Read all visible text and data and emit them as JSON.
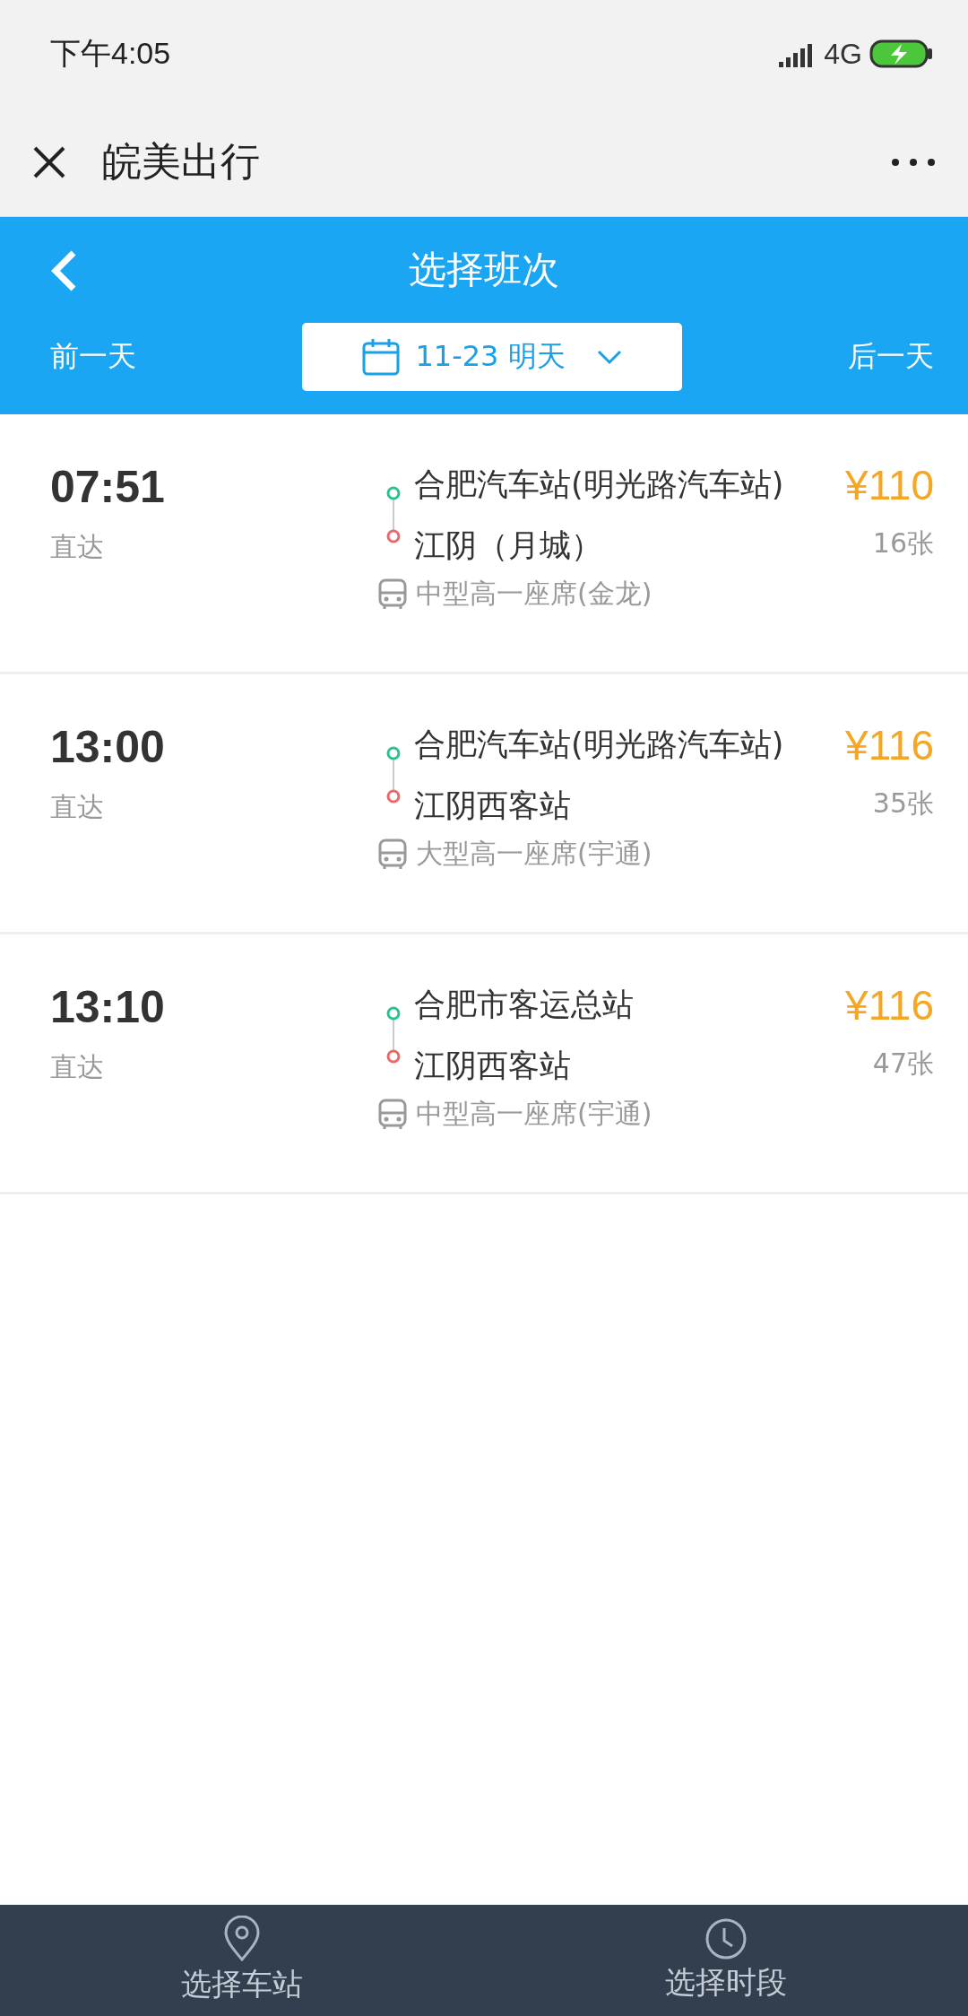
{
  "status_bar": {
    "time": "下午4:05",
    "network": "4G"
  },
  "app_bar": {
    "title": "皖美出行"
  },
  "header": {
    "title": "选择班次",
    "prev_day": "前一天",
    "date": "11-23 明天",
    "next_day": "后一天"
  },
  "trips": [
    {
      "time": "07:51",
      "type": "直达",
      "from": "合肥汽车站(明光路汽车站)",
      "to": "江阴（月城）",
      "price": "¥110",
      "tickets": "16张",
      "bus": "中型高一座席(金龙)"
    },
    {
      "time": "13:00",
      "type": "直达",
      "from": "合肥汽车站(明光路汽车站)",
      "to": "江阴西客站",
      "price": "¥116",
      "tickets": "35张",
      "bus": "大型高一座席(宇通)"
    },
    {
      "time": "13:10",
      "type": "直达",
      "from": "合肥市客运总站",
      "to": "江阴西客站",
      "price": "¥116",
      "tickets": "47张",
      "bus": "中型高一座席(宇通)"
    }
  ],
  "bottom_nav": [
    {
      "label": "选择车站",
      "kind": "station"
    },
    {
      "label": "选择时段",
      "kind": "time"
    }
  ]
}
